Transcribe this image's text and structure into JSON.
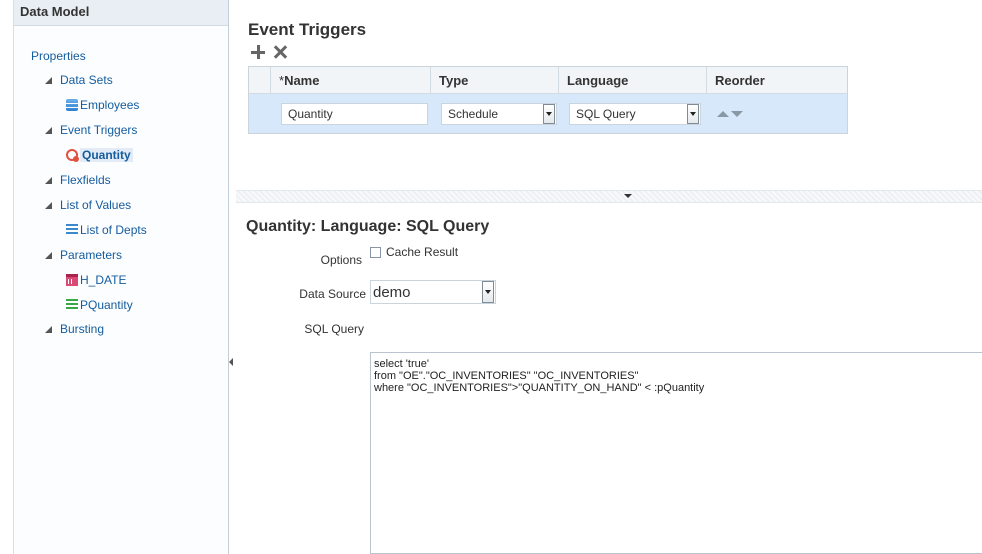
{
  "sidebar": {
    "title": "Data Model",
    "items": [
      {
        "label": "Properties",
        "level": 0
      },
      {
        "label": "Data Sets",
        "level": 1,
        "expander": true
      },
      {
        "label": "Employees",
        "level": 2,
        "icon": "database-icon"
      },
      {
        "label": "Event Triggers",
        "level": 1,
        "expander": true
      },
      {
        "label": "Quantity",
        "level": 2,
        "icon": "trigger-icon",
        "selected": true
      },
      {
        "label": "Flexfields",
        "level": 1,
        "expander": true
      },
      {
        "label": "List of Values",
        "level": 1,
        "expander": true
      },
      {
        "label": "List of Depts",
        "level": 2,
        "icon": "list-of-values-icon"
      },
      {
        "label": "Parameters",
        "level": 1,
        "expander": true
      },
      {
        "label": "H_DATE",
        "level": 2,
        "icon": "calendar-icon"
      },
      {
        "label": "PQuantity",
        "level": 2,
        "icon": "list-icon"
      },
      {
        "label": "Bursting",
        "level": 1,
        "expander": true
      }
    ]
  },
  "event_triggers": {
    "title": "Event Triggers",
    "columns": {
      "name": "Name",
      "required_marker": "*",
      "type": "Type",
      "language": "Language",
      "reorder": "Reorder"
    },
    "row": {
      "name": "Quantity",
      "type": "Schedule",
      "language": "SQL Query"
    }
  },
  "detail": {
    "title": "Quantity: Language: SQL Query",
    "options_label": "Options",
    "cache_result_label": "Cache Result",
    "cache_result_checked": false,
    "data_source_label": "Data Source",
    "data_source_value": "demo",
    "sql_query_label": "SQL Query",
    "sql_query": "select 'true'\nfrom \"OE\".\"OC_INVENTORIES\" \"OC_INVENTORIES\"\nwhere \"OC_INVENTORIES\">\"QUANTITY_ON_HAND\" < :pQuantity"
  },
  "colors": {
    "accent": "#145c9e",
    "selected_row": "#d6e8f9"
  }
}
